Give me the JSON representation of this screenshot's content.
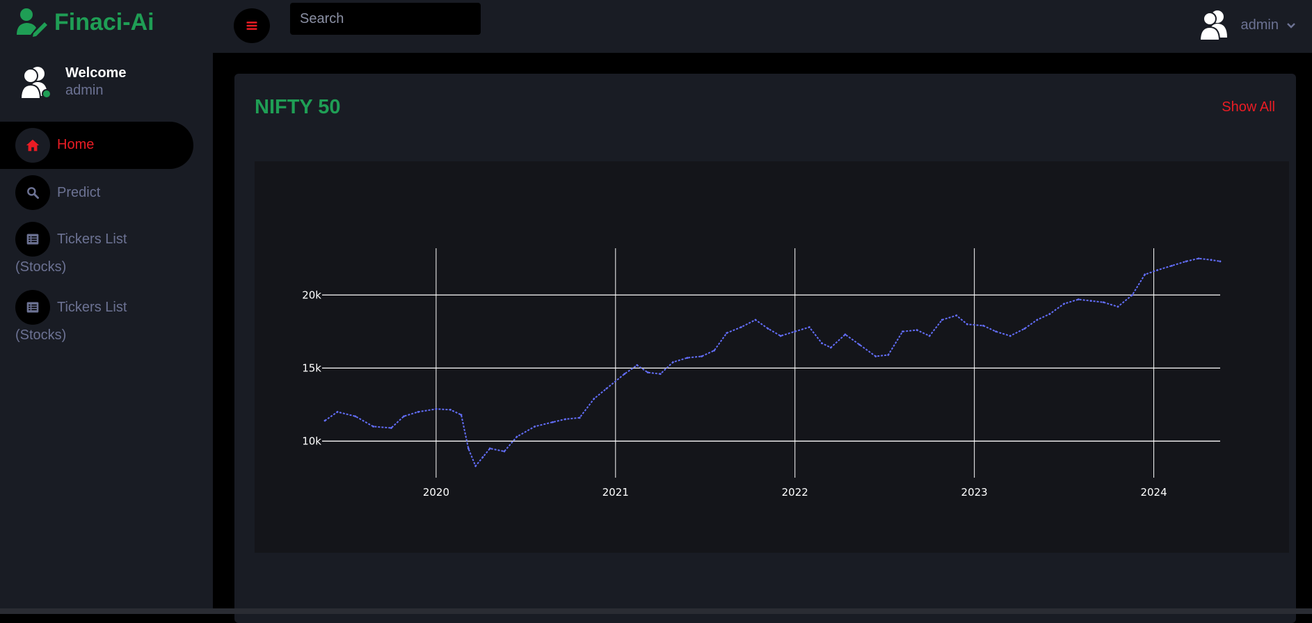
{
  "brand": {
    "name": "Finaci-Ai",
    "color": "#1f9e55"
  },
  "user": {
    "welcome": "Welcome",
    "name": "admin",
    "status_color": "#1f9e55"
  },
  "sidebar": {
    "items": [
      {
        "label": "Home",
        "icon": "home-icon",
        "active": true
      },
      {
        "label": "Predict",
        "icon": "search-icon"
      },
      {
        "label": "Tickers List",
        "sub": "(Stocks)",
        "icon": "list-icon"
      },
      {
        "label": "Tickers List",
        "sub": "(Stocks)",
        "icon": "list-icon"
      }
    ]
  },
  "header": {
    "menu_icon": "hamburger-icon",
    "search_placeholder": "Search",
    "profile_name": "admin",
    "profile_icon": "users-icon",
    "dropdown_icon": "chevron-down-icon"
  },
  "card": {
    "title": "NIFTY 50",
    "show_all": "Show All"
  },
  "colors": {
    "accent_red": "#ea1c24",
    "line": "#636efa",
    "panel": "#191c24"
  },
  "chart_data": {
    "type": "line",
    "title": "",
    "xlabel": "",
    "ylabel": "",
    "x_ticks": [
      "2020",
      "2021",
      "2022",
      "2023",
      "2024"
    ],
    "y_ticks": [
      "10k",
      "15k",
      "20k"
    ],
    "ylim": [
      7500,
      23200
    ],
    "xlim": [
      2019.38,
      2024.37
    ],
    "grid": true,
    "series": [
      {
        "color": "#636efa",
        "x": [
          2019.38,
          2019.45,
          2019.55,
          2019.65,
          2019.75,
          2019.82,
          2019.9,
          2020.0,
          2020.08,
          2020.14,
          2020.18,
          2020.22,
          2020.26,
          2020.3,
          2020.38,
          2020.45,
          2020.55,
          2020.65,
          2020.72,
          2020.8,
          2020.88,
          2020.95,
          2021.05,
          2021.12,
          2021.18,
          2021.25,
          2021.32,
          2021.4,
          2021.48,
          2021.55,
          2021.62,
          2021.7,
          2021.78,
          2021.85,
          2021.92,
          2022.0,
          2022.08,
          2022.15,
          2022.2,
          2022.28,
          2022.36,
          2022.45,
          2022.52,
          2022.6,
          2022.68,
          2022.75,
          2022.82,
          2022.9,
          2022.96,
          2023.05,
          2023.12,
          2023.2,
          2023.28,
          2023.35,
          2023.42,
          2023.5,
          2023.58,
          2023.65,
          2023.72,
          2023.8,
          2023.88,
          2023.95,
          2024.02,
          2024.1,
          2024.18,
          2024.25,
          2024.32,
          2024.37
        ],
        "y": [
          11400,
          12000,
          11700,
          11000,
          10900,
          11700,
          12000,
          12200,
          12150,
          11800,
          9500,
          8300,
          8900,
          9500,
          9300,
          10300,
          11000,
          11300,
          11500,
          11600,
          12900,
          13600,
          14600,
          15200,
          14700,
          14600,
          15400,
          15700,
          15800,
          16200,
          17400,
          17800,
          18300,
          17700,
          17200,
          17500,
          17800,
          16700,
          16400,
          17300,
          16600,
          15800,
          15900,
          17500,
          17600,
          17200,
          18300,
          18600,
          18000,
          17900,
          17500,
          17200,
          17700,
          18300,
          18700,
          19400,
          19700,
          19600,
          19500,
          19200,
          20000,
          21400,
          21700,
          22000,
          22300,
          22500,
          22400,
          22300
        ]
      }
    ]
  }
}
